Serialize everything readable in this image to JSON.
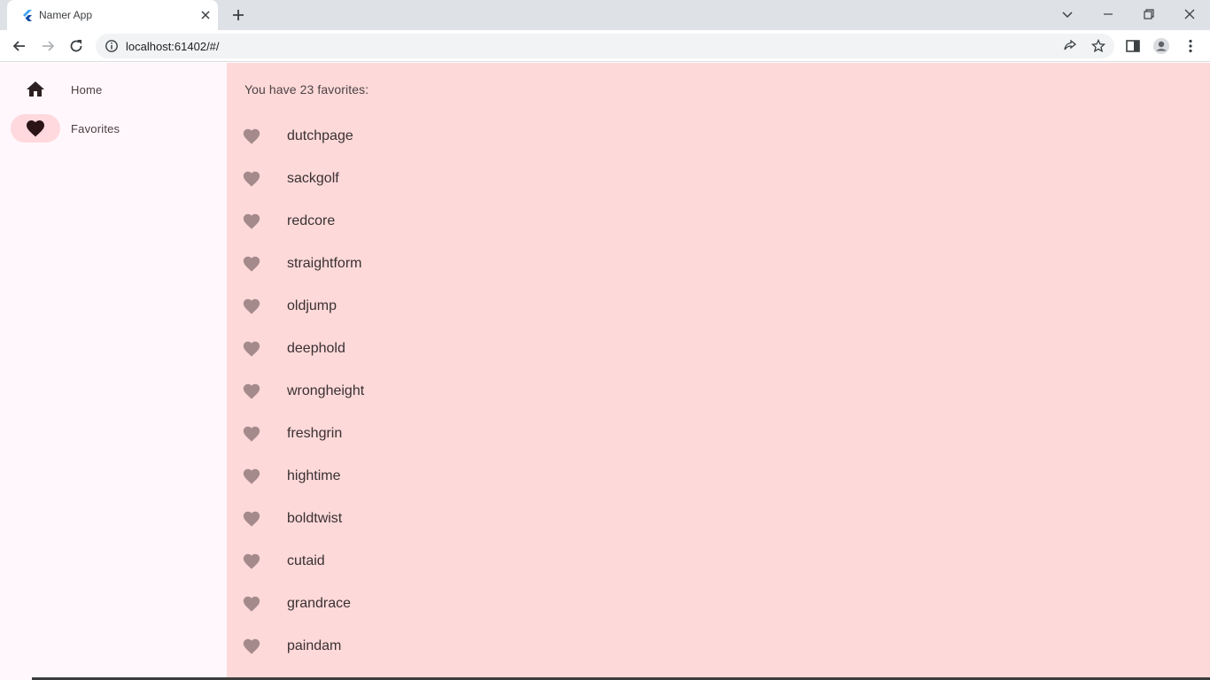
{
  "browser": {
    "tab_title": "Namer App",
    "url": "localhost:61402/#/"
  },
  "rail": {
    "items": [
      {
        "label": "Home",
        "icon": "home-icon",
        "selected": false
      },
      {
        "label": "Favorites",
        "icon": "heart-icon",
        "selected": true
      }
    ]
  },
  "favorites": {
    "heading": "You have 23 favorites:",
    "items": [
      "dutchpage",
      "sackgolf",
      "redcore",
      "straightform",
      "oldjump",
      "deephold",
      "wrongheight",
      "freshgrin",
      "hightime",
      "boldtwist",
      "cutaid",
      "grandrace",
      "paindam"
    ]
  },
  "colors": {
    "rail_bg": "#fff7fb",
    "content_bg": "#fdd9d9",
    "indicator": "#ffd9dd",
    "heart": "#a58a8c",
    "heart_active": "#2b1416"
  }
}
